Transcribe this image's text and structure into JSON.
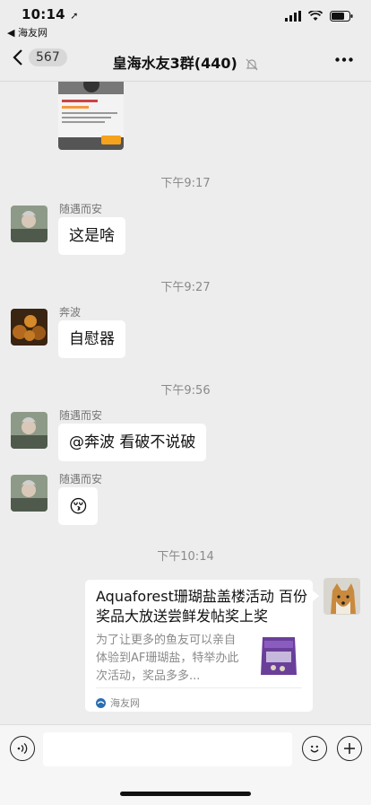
{
  "status_bar": {
    "time": "10:14",
    "back_app": "◀ 海友网"
  },
  "nav": {
    "back_count": "567",
    "title": "皇海水友3群(440)"
  },
  "messages": {
    "ts1": "下午9:17",
    "m1": {
      "sender": "随遇而安",
      "text": "这是啥"
    },
    "ts2": "下午9:27",
    "m2": {
      "sender": "奔波",
      "text": "自慰器"
    },
    "ts3": "下午9:56",
    "m3": {
      "sender": "随遇而安",
      "text": "@奔波 看破不说破"
    },
    "m4": {
      "sender": "随遇而安",
      "emoji": "😚"
    },
    "ts4": "下午10:14",
    "card": {
      "title": "Aquaforest珊瑚盐盖楼活动 百份奖品大放送尝鲜发帖奖上奖",
      "desc": "为了让更多的鱼友可以亲自体验到AF珊瑚盐，特举办此次活动，奖品多多...",
      "source": "海友网"
    }
  },
  "icons": [
    "voice-icon",
    "emoji-icon",
    "plus-icon",
    "mute-icon",
    "more-icon",
    "back-chevron-icon"
  ]
}
